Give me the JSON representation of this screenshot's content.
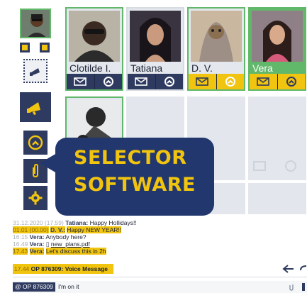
{
  "contacts": [
    {
      "name": "Clotilde I.",
      "selected": false
    },
    {
      "name": "Tatiana",
      "selected": false
    },
    {
      "name": "D. V.",
      "selected": false
    },
    {
      "name": "Vera",
      "selected": true
    }
  ],
  "banner": {
    "line1": "SELECTOR",
    "line2": "SOFTWARE"
  },
  "messages": [
    {
      "ts": "31.12.2020 (17.59)",
      "who": "Tatiana:",
      "text": "Happy Hollidays!!",
      "highlight": false
    },
    {
      "ts": "01.01 (00.00)",
      "who": "D. V.:",
      "text": "Happy NEW YEAR!!",
      "highlight": true
    },
    {
      "ts": "16.15",
      "who": "Vera:",
      "text": "Anybody here?",
      "highlight": false
    },
    {
      "ts": "16.49",
      "who": "Vera:",
      "text": "new_plans.pdf",
      "highlight": false,
      "attachment": true
    },
    {
      "ts": "17.43",
      "who": "Vera:",
      "text": "Let's discuss this in 2h",
      "highlight": true
    }
  ],
  "voice_message": {
    "ts": "17.44",
    "text": "OP 876309: Voice Message"
  },
  "input": {
    "badge": "@ OP 876309",
    "text": "I'm on it"
  },
  "colors": {
    "navy": "#2e3a5f",
    "yellow": "#f1c40f",
    "green": "#62b86a",
    "banner": "#22376e"
  }
}
